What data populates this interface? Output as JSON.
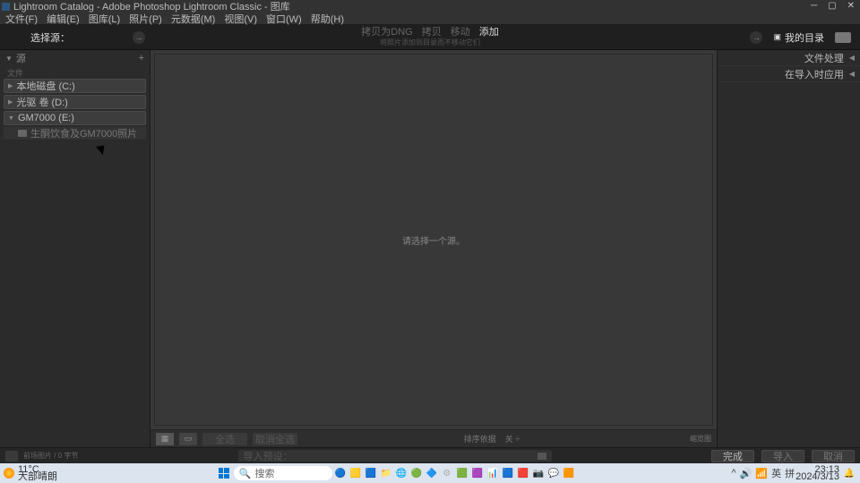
{
  "title": "Lightroom Catalog - Adobe Photoshop Lightroom Classic - 图库",
  "menu": [
    "文件(F)",
    "编辑(E)",
    "图库(L)",
    "照片(P)",
    "元数据(M)",
    "视图(V)",
    "窗口(W)",
    "帮助(H)"
  ],
  "topstrip": {
    "select_source": "选择源：",
    "opts": {
      "dng": "拷贝为DNG",
      "copy": "拷贝",
      "move": "移动",
      "add": "添加"
    },
    "sub": "将照片添加到目录而不移动它们",
    "dest": "我的目录"
  },
  "leftpanel": {
    "head": "源",
    "plus": "+",
    "file_hdr": "文件",
    "drives": [
      {
        "label": "本地磁盘 (C:)",
        "open": false
      },
      {
        "label": "光驱 卷 (D:)",
        "open": false
      },
      {
        "label": "GM7000 (E:)",
        "open": true,
        "children": [
          {
            "label": "生酮饮食及GM7000照片"
          }
        ]
      }
    ]
  },
  "center": {
    "empty_msg": "请选择一个源。",
    "select_all": "全选",
    "deselect_all": "取消全选",
    "sort_label": "排序依据",
    "sort_value": "关 ÷",
    "zoom": "缩览图"
  },
  "rightpanel": {
    "sections": [
      "文件处理",
      "在导入时应用"
    ]
  },
  "bottom": {
    "info": "前场图片 / 0 字节",
    "filter_placeholder": "导入预设：",
    "done": "完成",
    "import": "导入",
    "cancel": "取消"
  },
  "taskbar": {
    "temp": "11°C",
    "cond": "大部晴朗",
    "search": "搜索",
    "time": "23:13",
    "date": "2024/3/13"
  }
}
